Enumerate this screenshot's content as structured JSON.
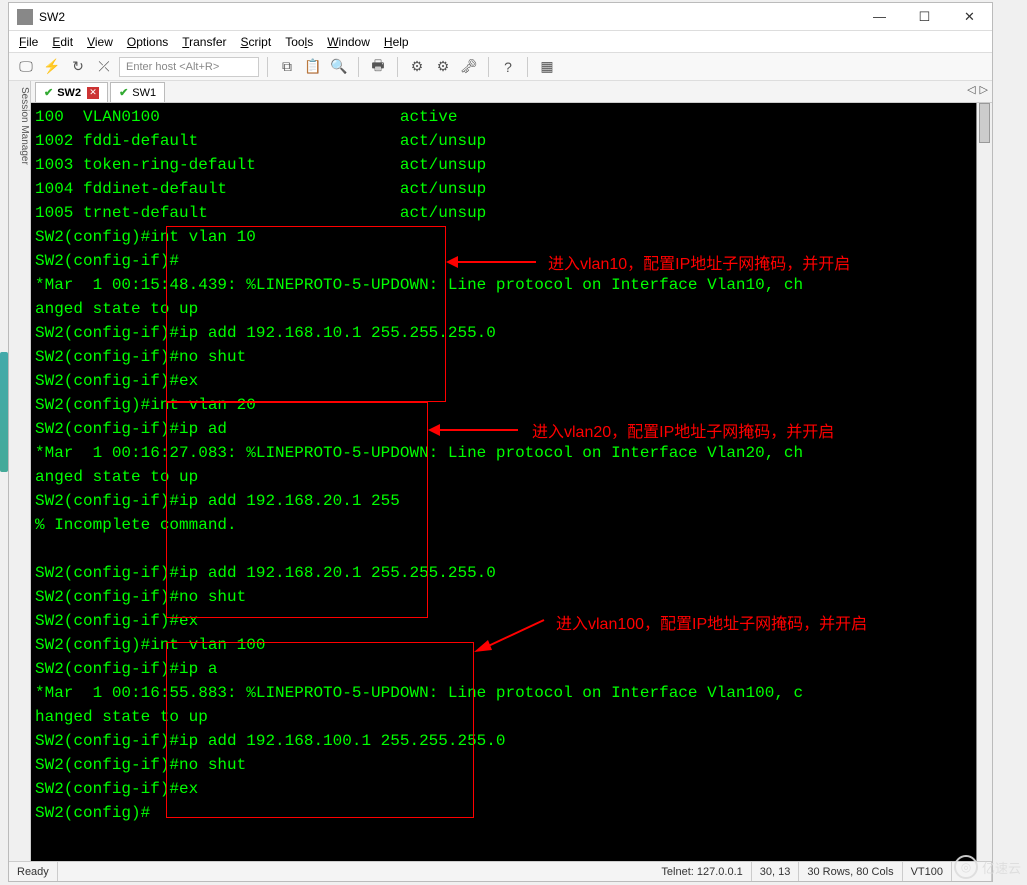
{
  "window": {
    "title": "SW2"
  },
  "menu": [
    "File",
    "Edit",
    "View",
    "Options",
    "Transfer",
    "Script",
    "Tools",
    "Window",
    "Help"
  ],
  "toolbar": {
    "host_placeholder": "Enter host <Alt+R>"
  },
  "sidebar": {
    "label": "Session Manager"
  },
  "tabs": [
    {
      "name": "SW2",
      "active": true,
      "closeable": true
    },
    {
      "name": "SW1",
      "active": false,
      "closeable": false
    }
  ],
  "terminal_lines": [
    "100  VLAN0100                         active",
    "1002 fddi-default                     act/unsup",
    "1003 token-ring-default               act/unsup",
    "1004 fddinet-default                  act/unsup",
    "1005 trnet-default                    act/unsup",
    "SW2(config)#int vlan 10",
    "SW2(config-if)#",
    "*Mar  1 00:15:48.439: %LINEPROTO-5-UPDOWN: Line protocol on Interface Vlan10, ch",
    "anged state to up",
    "SW2(config-if)#ip add 192.168.10.1 255.255.255.0",
    "SW2(config-if)#no shut",
    "SW2(config-if)#ex",
    "SW2(config)#int vlan 20",
    "SW2(config-if)#ip ad",
    "*Mar  1 00:16:27.083: %LINEPROTO-5-UPDOWN: Line protocol on Interface Vlan20, ch",
    "anged state to up",
    "SW2(config-if)#ip add 192.168.20.1 255",
    "% Incomplete command.",
    "",
    "SW2(config-if)#ip add 192.168.20.1 255.255.255.0",
    "SW2(config-if)#no shut",
    "SW2(config-if)#ex",
    "SW2(config)#int vlan 100",
    "SW2(config-if)#ip a",
    "*Mar  1 00:16:55.883: %LINEPROTO-5-UPDOWN: Line protocol on Interface Vlan100, c",
    "hanged state to up",
    "SW2(config-if)#ip add 192.168.100.1 255.255.255.0",
    "SW2(config-if)#no shut",
    "SW2(config-if)#ex",
    "SW2(config)#"
  ],
  "status": {
    "ready": "Ready",
    "conn": "Telnet: 127.0.0.1",
    "pos": "30,  13",
    "size": "30 Rows, 80 Cols",
    "emul": "VT100"
  },
  "annotations": {
    "a1": "进入vlan10，配置IP地址子网掩码，并开启",
    "a2": "进入vlan20，配置IP地址子网掩码，并开启",
    "a3": "进入vlan100，配置IP地址子网掩码，并开启"
  },
  "watermark": "亿速云"
}
